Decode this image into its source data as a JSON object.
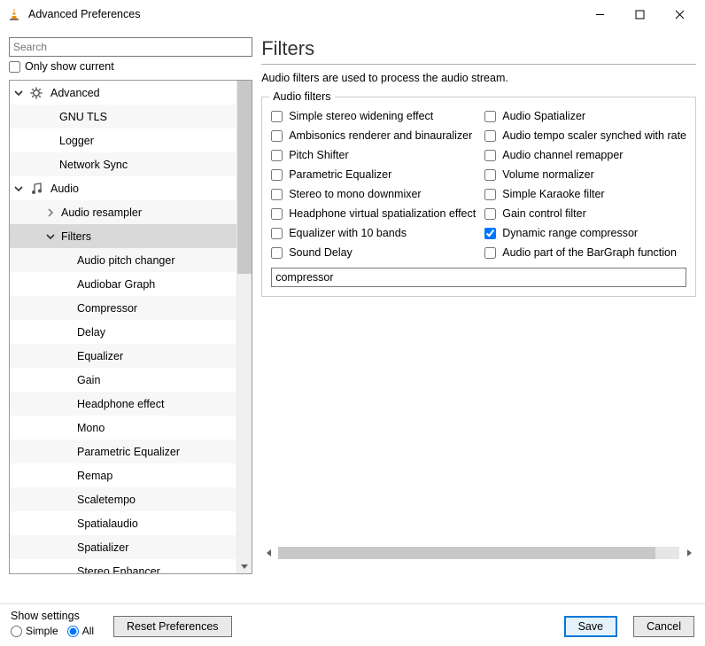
{
  "window": {
    "title": "Advanced Preferences"
  },
  "search": {
    "placeholder": "Search"
  },
  "only_current": {
    "label": "Only show current",
    "checked": false
  },
  "tree": {
    "items": [
      {
        "label": "Advanced",
        "level": 0,
        "has_expander": true,
        "expanded": true,
        "icon": "gear"
      },
      {
        "label": "GNU TLS",
        "level": 1,
        "has_expander": false,
        "striped": true
      },
      {
        "label": "Logger",
        "level": 1,
        "has_expander": false
      },
      {
        "label": "Network Sync",
        "level": 1,
        "has_expander": false,
        "striped": true
      },
      {
        "label": "Audio",
        "level": 0,
        "has_expander": true,
        "expanded": true,
        "icon": "music"
      },
      {
        "label": "Audio resampler",
        "level": 2,
        "has_expander": true,
        "expanded": false,
        "striped": true
      },
      {
        "label": "Filters",
        "level": 2,
        "has_expander": true,
        "expanded": true,
        "selected": true
      },
      {
        "label": "Audio pitch changer",
        "level": 3,
        "has_expander": false,
        "striped": true
      },
      {
        "label": "Audiobar Graph",
        "level": 3,
        "has_expander": false
      },
      {
        "label": "Compressor",
        "level": 3,
        "has_expander": false,
        "striped": true
      },
      {
        "label": "Delay",
        "level": 3,
        "has_expander": false
      },
      {
        "label": "Equalizer",
        "level": 3,
        "has_expander": false,
        "striped": true
      },
      {
        "label": "Gain",
        "level": 3,
        "has_expander": false
      },
      {
        "label": "Headphone effect",
        "level": 3,
        "has_expander": false,
        "striped": true
      },
      {
        "label": "Mono",
        "level": 3,
        "has_expander": false
      },
      {
        "label": "Parametric Equalizer",
        "level": 3,
        "has_expander": false,
        "striped": true
      },
      {
        "label": "Remap",
        "level": 3,
        "has_expander": false
      },
      {
        "label": "Scaletempo",
        "level": 3,
        "has_expander": false,
        "striped": true
      },
      {
        "label": "Spatialaudio",
        "level": 3,
        "has_expander": false
      },
      {
        "label": "Spatializer",
        "level": 3,
        "has_expander": false,
        "striped": true
      },
      {
        "label": "Stereo Enhancer",
        "level": 3,
        "has_expander": false
      }
    ]
  },
  "page": {
    "title": "Filters",
    "description": "Audio filters are used to process the audio stream."
  },
  "groupbox": {
    "title": "Audio filters",
    "filters_left": [
      {
        "label": "Simple stereo widening effect",
        "checked": false
      },
      {
        "label": "Ambisonics renderer and binauralizer",
        "checked": false
      },
      {
        "label": "Pitch Shifter",
        "checked": false
      },
      {
        "label": "Parametric Equalizer",
        "checked": false
      },
      {
        "label": "Stereo to mono downmixer",
        "checked": false
      },
      {
        "label": "Headphone virtual spatialization effect",
        "checked": false
      },
      {
        "label": "Equalizer with 10 bands",
        "checked": false
      },
      {
        "label": "Sound Delay",
        "checked": false
      }
    ],
    "filters_right": [
      {
        "label": "Audio Spatializer",
        "checked": false
      },
      {
        "label": "Audio tempo scaler synched with rate",
        "checked": false
      },
      {
        "label": "Audio channel remapper",
        "checked": false
      },
      {
        "label": "Volume normalizer",
        "checked": false
      },
      {
        "label": "Simple Karaoke filter",
        "checked": false
      },
      {
        "label": "Gain control filter",
        "checked": false
      },
      {
        "label": "Dynamic range compressor",
        "checked": true
      },
      {
        "label": "Audio part of the BarGraph function",
        "checked": false
      }
    ],
    "text_value": "compressor"
  },
  "bottom": {
    "show_settings_label": "Show settings",
    "simple_label": "Simple",
    "all_label": "All",
    "selected": "all",
    "reset_label": "Reset Preferences",
    "save_label": "Save",
    "cancel_label": "Cancel"
  }
}
